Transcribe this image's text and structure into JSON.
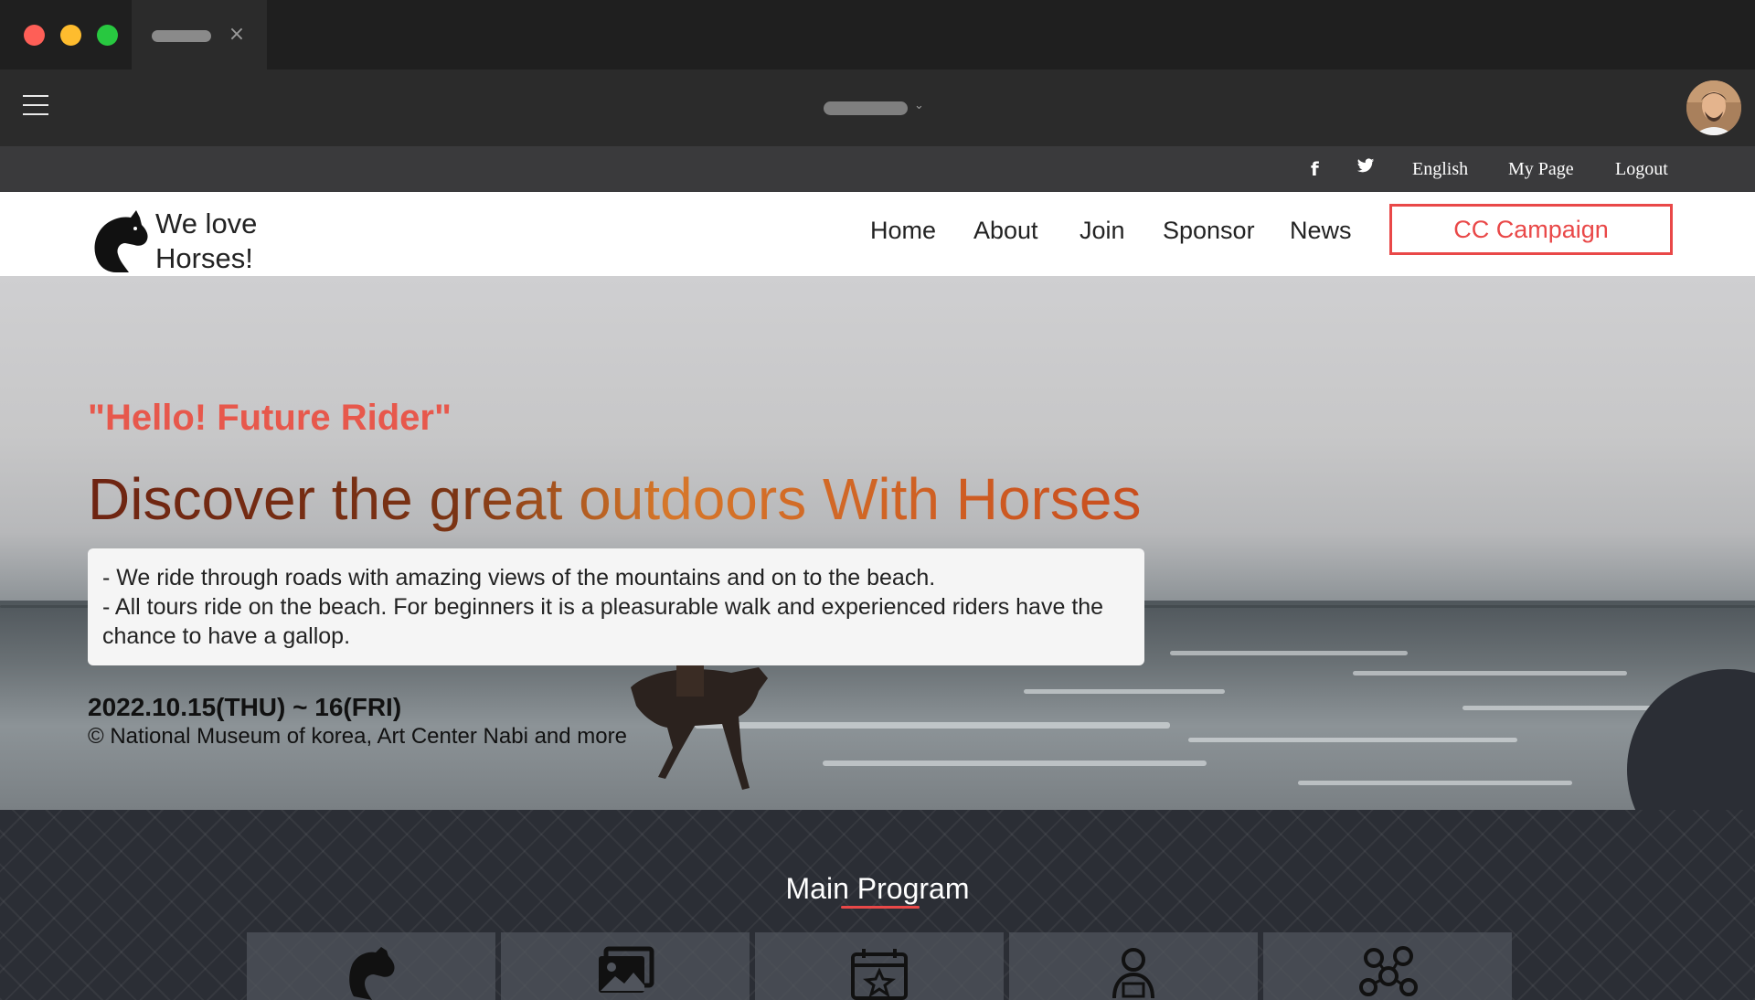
{
  "browser": {
    "tab_close_glyph": "×",
    "url_chevron_glyph": "⌄",
    "icons": [
      "window-close-dot",
      "window-minimize-dot",
      "window-zoom-dot",
      "menu-icon",
      "avatar"
    ]
  },
  "topbar": {
    "facebook_glyph": "f",
    "twitter_glyph": "🐦",
    "language": "English",
    "my_page": "My Page",
    "logout": "Logout"
  },
  "nav": {
    "logo_line1": "We love",
    "logo_line2": "Horses!",
    "items": [
      "Home",
      "About",
      "Join",
      "Sponsor",
      "News"
    ],
    "cta": "CC Campaign",
    "cta_color": "#e94848"
  },
  "hero": {
    "kicker": "\"Hello! Future Rider\"",
    "title": "Discover the great outdoors With Horses",
    "bullets": [
      "- We ride through roads with amazing views of the mountains and on to the beach.",
      "- All tours ride on the beach. For beginners it is a pleasurable walk and experienced riders have the chance to have a gallop."
    ],
    "date": "2022.10.15(THU) ~ 16(FRI)",
    "credit": "© National Museum of korea, Art Center Nabi and more",
    "kicker_color": "#e7584c"
  },
  "program": {
    "title": "Main Program",
    "cards": [
      {
        "icon": "horse-icon"
      },
      {
        "icon": "gallery-icon"
      },
      {
        "icon": "calendar-star-icon"
      },
      {
        "icon": "person-laptop-icon"
      },
      {
        "icon": "network-people-icon"
      }
    ]
  }
}
